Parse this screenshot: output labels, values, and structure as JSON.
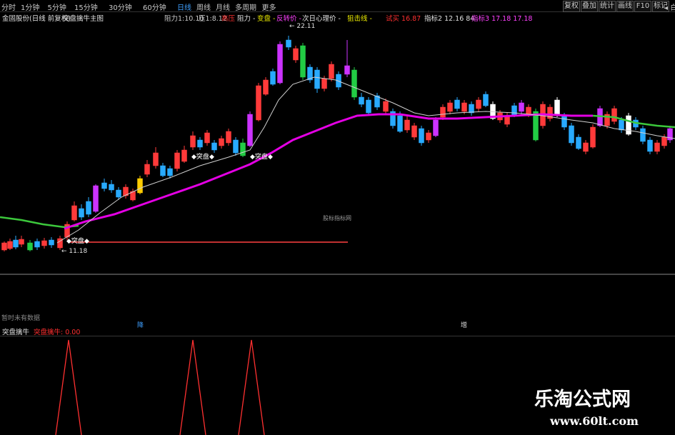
{
  "toolbar": {
    "periods": [
      "分时",
      "1分钟",
      "5分钟",
      "15分钟",
      "30分钟",
      "60分钟",
      "日线",
      "周线",
      "月线",
      "多周期",
      "更多"
    ],
    "active_period": "日线",
    "right_buttons": [
      "复权",
      "叠加",
      "统计",
      "画线",
      "F10",
      "标记"
    ],
    "arrow_label": "◂ 白"
  },
  "info": {
    "stock_title": "金固股份(日线 前复权)",
    "indicator_name": "突盘擒牛主图",
    "resistance1": "阻力1:10.10",
    "pressure": "压1:8.12",
    "high_pressure": "高压",
    "resistance": "阻力 -",
    "change": "变盘 -",
    "reversal": "反转价 -",
    "next_day_price": "次日心理价 -",
    "strike_line": "狙击线 -",
    "buy": "试买 16.87",
    "indicator2": "指标2 12.16 84",
    "indicator3": "指标3 17.18 17.18"
  },
  "chart": {
    "high_price_label": "22.11",
    "low_price_label": "11.18",
    "signal_label": "突盘",
    "center_watermark": "股标指标网",
    "no_data_text": "暂时未有数据",
    "bottom_markers": [
      "降",
      "增"
    ]
  },
  "indicator_panel": {
    "title": "突盘擒牛",
    "value_label": "突盘擒牛: 0.00"
  },
  "watermark": {
    "title": "乐淘公式网",
    "url": "www.60lt.com"
  },
  "colors": {
    "up": "#ff3a3a",
    "down": "#28aaff",
    "magenta_line": "#e400e4",
    "green_line": "#3cc83c",
    "white_line": "#d0d0d0",
    "signal": "#ffffff",
    "indicator_line": "#ff3030"
  }
}
